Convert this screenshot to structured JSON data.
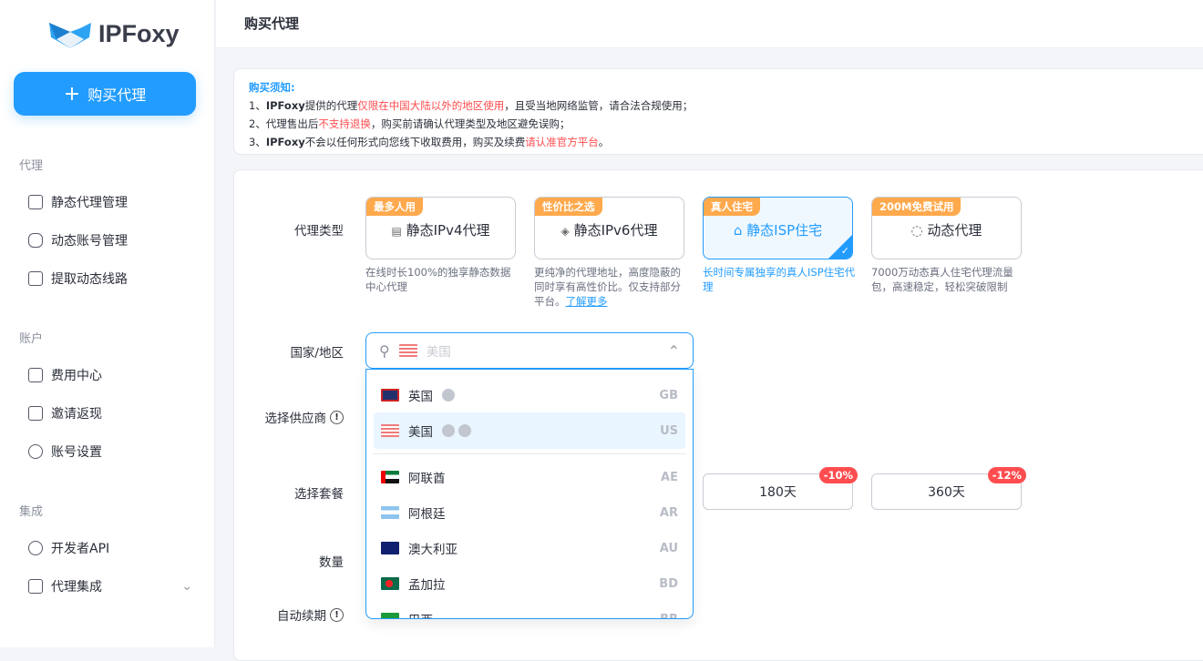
{
  "brand": {
    "name": "IPFoxy",
    "accent": "#229cff"
  },
  "sidebar": {
    "buy_button": "购买代理",
    "sections": [
      {
        "title": "代理",
        "items": [
          "静态代理管理",
          "动态账号管理",
          "提取动态线路"
        ]
      },
      {
        "title": "账户",
        "items": [
          "费用中心",
          "邀请返现",
          "账号设置"
        ]
      },
      {
        "title": "集成",
        "items": [
          "开发者API",
          "代理集成"
        ]
      }
    ]
  },
  "header": {
    "title": "购买代理"
  },
  "notice": {
    "heading": "购买须知:",
    "l1": [
      "1、",
      "IPFoxy",
      "提供的代理",
      "仅限在中国大陆以外的地区使用",
      "，且受当地网络监管，请合法合规使用；"
    ],
    "l2": [
      "2、代理售出后",
      "不支持退换",
      "，购买前请确认代理类型及地区避免误购；"
    ],
    "l3": [
      "3、",
      "IPFoxy",
      "不会以任何形式向您线下收取费用，购买及续费",
      "请认准官方平台",
      "。"
    ]
  },
  "form": {
    "labels": {
      "type": "代理类型",
      "country": "国家/地区",
      "provider": "选择供应商",
      "plan": "选择套餐",
      "qty": "数量",
      "renew": "自动续期"
    },
    "types": [
      {
        "tag": "最多人用",
        "name": "静态IPv4代理",
        "icon": "▤",
        "desc": "在线时长100%的独享静态数据中心代理"
      },
      {
        "tag": "性价比之选",
        "name": "静态IPv6代理",
        "icon": "◈",
        "desc": "更纯净的代理地址，高度隐蔽的同时享有高性价比。仅支持部分平台。",
        "link": "了解更多"
      },
      {
        "tag": "真人住宅",
        "name": "静态ISP住宅",
        "icon": "⌂",
        "desc": "长时间专属独享的真人ISP住宅代理",
        "selected": true
      },
      {
        "tag": "200M免费试用",
        "name": "动态代理",
        "icon": "◌",
        "desc": "7000万动态真人住宅代理流量包，高速稳定，轻松突破限制"
      }
    ],
    "country_placeholder": "美国",
    "countries": [
      {
        "name": "英国",
        "code": "GB"
      },
      {
        "name": "美国",
        "code": "US"
      },
      {
        "name": "阿联酋",
        "code": "AE"
      },
      {
        "name": "阿根廷",
        "code": "AR"
      },
      {
        "name": "澳大利亚",
        "code": "AU"
      },
      {
        "name": "孟加拉",
        "code": "BD"
      },
      {
        "name": "巴西",
        "code": "BR"
      }
    ],
    "plans": [
      {
        "label": "180天",
        "discount": "-10%"
      },
      {
        "label": "360天",
        "discount": "-12%"
      }
    ]
  }
}
